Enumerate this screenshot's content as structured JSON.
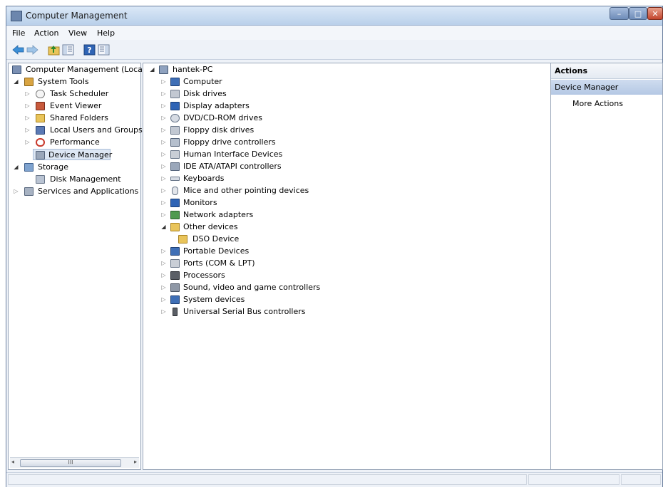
{
  "window": {
    "title": "Computer Management"
  },
  "menu": [
    "File",
    "Action",
    "View",
    "Help"
  ],
  "left_tree": [
    {
      "label": "Computer Management (Local",
      "icon": "computer-management-icon"
    },
    {
      "label": "System Tools",
      "icon": "tools-icon"
    },
    {
      "label": "Task Scheduler",
      "icon": "clock-icon"
    },
    {
      "label": "Event Viewer",
      "icon": "event-viewer-icon"
    },
    {
      "label": "Shared Folders",
      "icon": "shared-folder-icon"
    },
    {
      "label": "Local Users and Groups",
      "icon": "users-icon"
    },
    {
      "label": "Performance",
      "icon": "performance-icon"
    },
    {
      "label": "Device Manager",
      "icon": "device-manager-icon"
    },
    {
      "label": "Storage",
      "icon": "storage-icon"
    },
    {
      "label": "Disk Management",
      "icon": "disk-icon"
    },
    {
      "label": "Services and Applications",
      "icon": "services-icon"
    }
  ],
  "scrollbar_thumb_label": "III",
  "device_tree": {
    "root": "hantek-PC",
    "categories": [
      "Computer",
      "Disk drives",
      "Display adapters",
      "DVD/CD-ROM drives",
      "Floppy disk drives",
      "Floppy drive controllers",
      "Human Interface Devices",
      "IDE ATA/ATAPI controllers",
      "Keyboards",
      "Mice and other pointing devices",
      "Monitors",
      "Network adapters",
      "Other devices",
      "DSO Device",
      "Portable Devices",
      "Ports (COM & LPT)",
      "Processors",
      "Sound, video and game controllers",
      "System devices",
      "Universal Serial Bus controllers"
    ]
  },
  "actions": {
    "header": "Actions",
    "section": "Device Manager",
    "more": "More Actions"
  },
  "colors": {
    "accent": "#3b6fb6",
    "selection": "#dde7f4"
  }
}
